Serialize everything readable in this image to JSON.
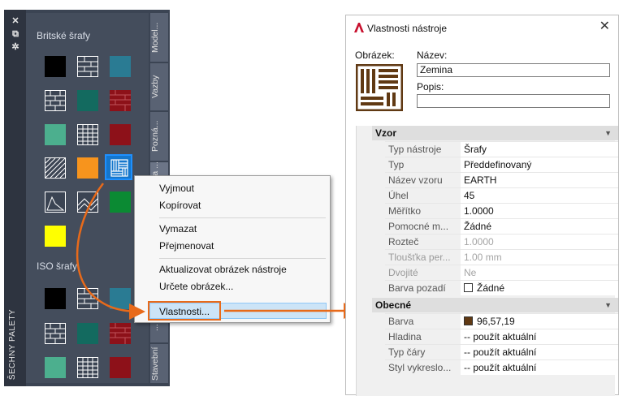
{
  "palette": {
    "strip_title": "ŠECHNY PALETY",
    "strip_buttons": [
      "✕",
      "⧉",
      "✲"
    ],
    "group1_title": "Britské šrafy",
    "group2_title": "ISO šrafy",
    "tabs": [
      "Model...",
      "Vazby",
      "Pozná...",
      "Šrafy a ...",
      "...",
      "Stavební"
    ]
  },
  "context_menu": {
    "items": [
      {
        "label": "Vyjmout"
      },
      {
        "label": "Kopírovat"
      },
      {
        "label": "Vymazat"
      },
      {
        "label": "Přejmenovat"
      },
      {
        "label": "Aktualizovat obrázek nástroje"
      },
      {
        "label": "Určete obrázek..."
      },
      {
        "label": "Vlastnosti..."
      }
    ]
  },
  "dialog": {
    "title": "Vlastnosti nástroje",
    "close_glyph": "✕",
    "image_label": "Obrázek:",
    "name_label": "Název:",
    "name_value": "Zemina",
    "desc_label": "Popis:",
    "desc_value": "",
    "sections": [
      {
        "title": "Vzor",
        "rows": [
          {
            "name": "Typ nástroje",
            "value": "Šrafy"
          },
          {
            "name": "Typ",
            "value": "Předdefinovaný"
          },
          {
            "name": "Název vzoru",
            "value": "EARTH"
          },
          {
            "name": "Úhel",
            "value": "45"
          },
          {
            "name": "Měřítko",
            "value": "1.0000"
          },
          {
            "name": "Pomocné m...",
            "value": "Žádné"
          },
          {
            "name": "Rozteč",
            "value": "1.0000"
          },
          {
            "name": "Tloušťka per...",
            "value": "1.00 mm"
          },
          {
            "name": "Dvojité",
            "value": "Ne"
          },
          {
            "name": "Barva pozadí",
            "value": "Žádné"
          }
        ]
      },
      {
        "title": "Obecné",
        "rows": [
          {
            "name": "Barva",
            "value": "96,57,19"
          },
          {
            "name": "Hladina",
            "value": "-- použít aktuální"
          },
          {
            "name": "Typ čáry",
            "value": "-- použít aktuální"
          },
          {
            "name": "Styl vykreslo...",
            "value": "-- použít aktuální"
          }
        ]
      }
    ],
    "colors": {
      "barva_swatch": "#603913"
    }
  }
}
